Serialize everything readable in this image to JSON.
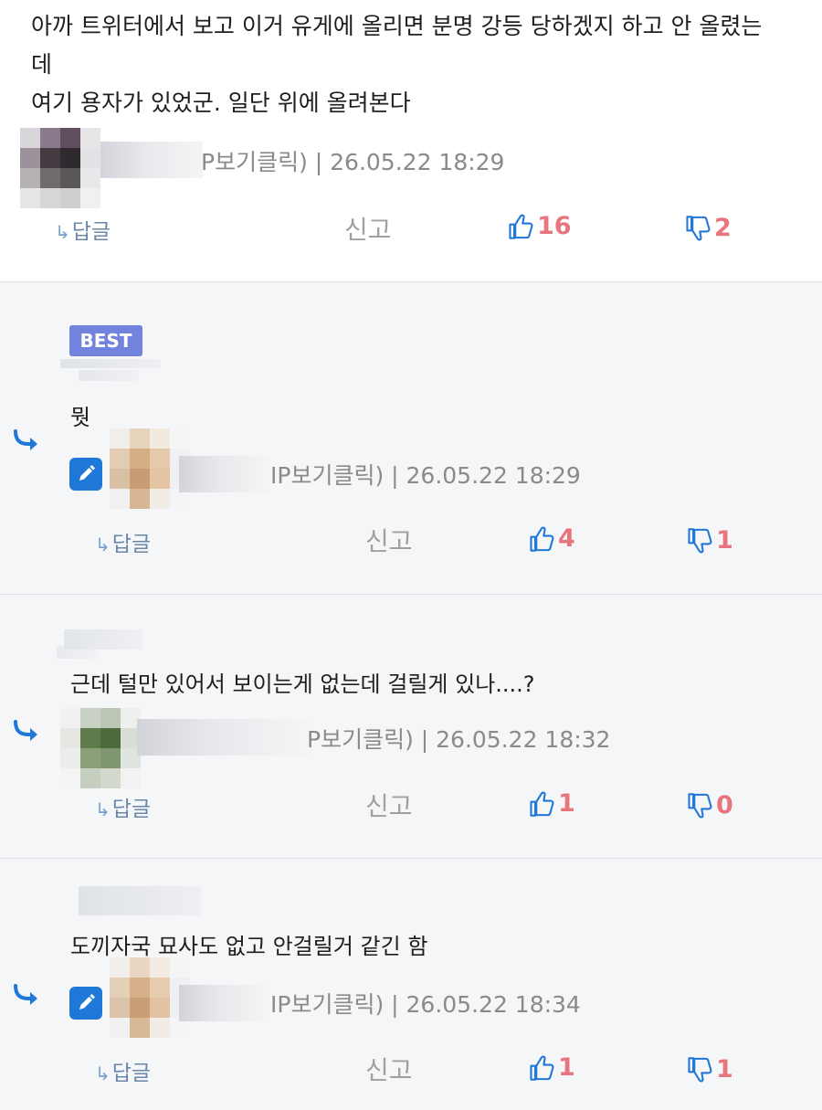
{
  "main_comment": {
    "lines": [
      "아까 트위터에서 보고 이거 유게에 올리면 분명 강등 당하겠지 하고 안 올렸는",
      "데",
      "여기 용자가 있었군. 일단 위에 올려본다"
    ],
    "meta": "P보기클릭) | 26.05.22 18:29",
    "actions": {
      "reply": "답글",
      "report": "신고",
      "likes": "16",
      "dislikes": "2"
    }
  },
  "replies": [
    {
      "badge": "BEST",
      "text": "뭣",
      "meta": "IP보기클릭) | 26.05.22 18:29",
      "actions": {
        "reply": "답글",
        "report": "신고",
        "likes": "4",
        "dislikes": "1"
      }
    },
    {
      "text": "근데 털만 있어서 보이는게 없는데 걸릴게 있나....?",
      "meta": "P보기클릭) | 26.05.22 18:32",
      "actions": {
        "reply": "답글",
        "report": "신고",
        "likes": "1",
        "dislikes": "0"
      }
    },
    {
      "text": "도끼자국 묘사도 없고 안걸릴거 같긴 함",
      "meta": "IP보기클릭) | 26.05.22 18:34",
      "actions": {
        "reply": "답글",
        "report": "신고",
        "likes": "1",
        "dislikes": "1"
      }
    }
  ],
  "icons": {
    "reply_arrow": "reply-arrow-icon",
    "edit": "pencil-icon",
    "like": "thumbs-up-icon",
    "dislike": "thumbs-down-icon"
  },
  "colors": {
    "best_badge": "#7283de",
    "count": "#e8747e",
    "icon_blue": "#1f78d8",
    "reply_bg": "#f5f6f7"
  }
}
